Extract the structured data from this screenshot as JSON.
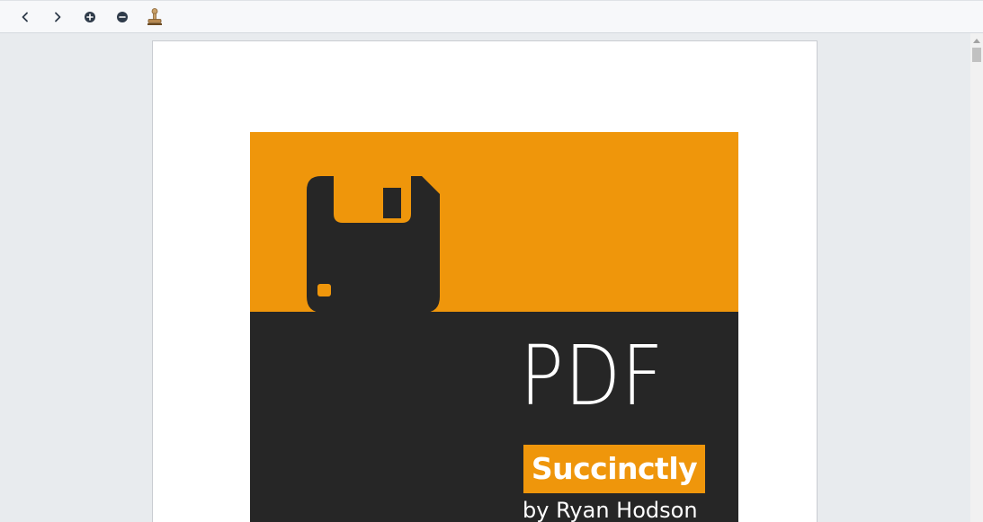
{
  "toolbar": {
    "buttons": [
      {
        "name": "previous-page-button",
        "icon": "chevron-left-icon"
      },
      {
        "name": "next-page-button",
        "icon": "chevron-right-icon"
      },
      {
        "name": "zoom-in-button",
        "icon": "plus-circle-icon"
      },
      {
        "name": "zoom-out-button",
        "icon": "minus-circle-icon"
      },
      {
        "name": "stamp-button",
        "icon": "stamp-icon"
      }
    ]
  },
  "document": {
    "cover": {
      "title": "PDF",
      "series": "Succinctly",
      "author": "by Ryan Hodson",
      "icon": "floppy-disk-icon",
      "colors": {
        "accent": "#ef960b",
        "dark": "#262626",
        "text": "#ffffff"
      }
    }
  },
  "colors": {
    "toolbar_bg": "#f7f8fa",
    "viewer_bg": "#e8ebee",
    "icon": "#2f3b4a"
  }
}
